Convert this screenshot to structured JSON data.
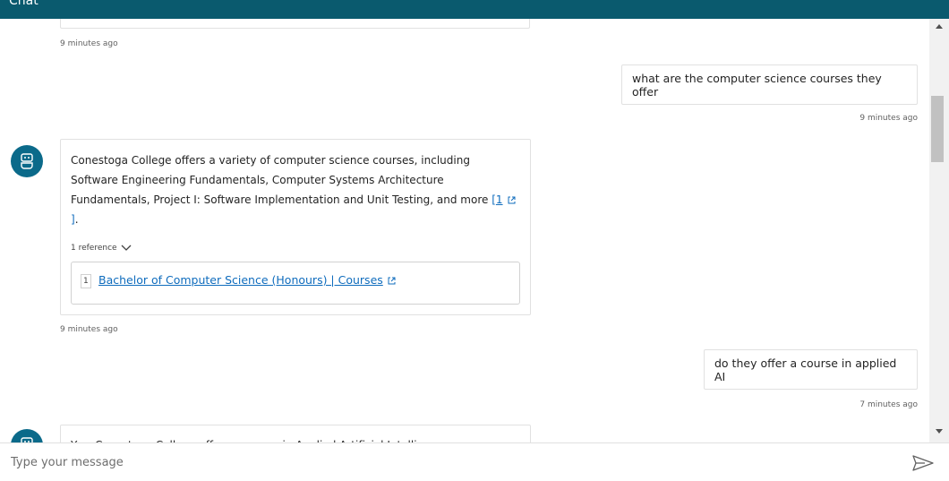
{
  "header": {
    "title": "Chat"
  },
  "messages": [
    {
      "role": "bot",
      "timestamp": "9 minutes ago"
    },
    {
      "role": "user",
      "text": "what are the computer science courses they offer",
      "timestamp": "9 minutes ago"
    },
    {
      "role": "bot",
      "text": "Conestoga College offers a variety of computer science courses, including Software Engineering Fundamentals, Computer Systems Architecture Fundamentals, Project I: Software Implementation and Unit Testing, and more ",
      "citation_label": "1",
      "text_end": ".",
      "references_label": "1 reference",
      "references": [
        {
          "number": "1",
          "title": "Bachelor of Computer Science (Honours) | Courses"
        }
      ],
      "timestamp": "9 minutes ago"
    },
    {
      "role": "user",
      "text": "do they offer a course in applied AI",
      "timestamp": "7 minutes ago"
    },
    {
      "role": "bot",
      "text": "Yes, Conestoga College offers a course in Applied Artificial Intelligence"
    }
  ],
  "composer": {
    "placeholder": "Type your message"
  },
  "colors": {
    "header": "#0a5a6e",
    "avatar": "#0b6a8a",
    "link": "#0f6cbd"
  }
}
